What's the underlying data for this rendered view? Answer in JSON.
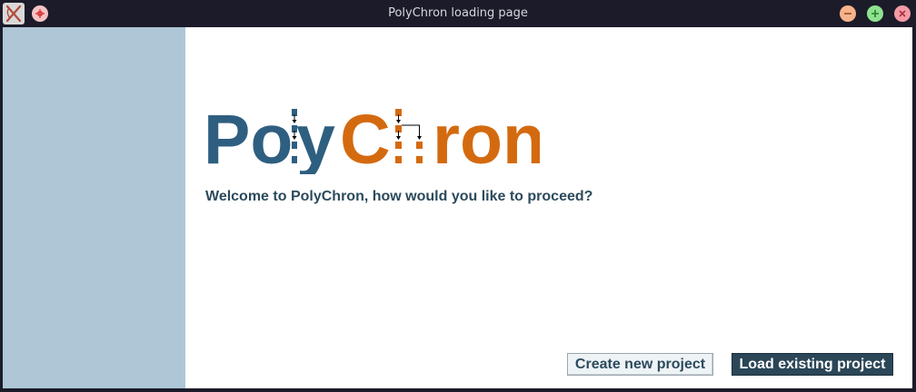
{
  "window": {
    "title": "PolyChron loading page"
  },
  "logo": {
    "part1": "Po",
    "part2": "y",
    "part3": "C",
    "part4": "ron",
    "color_blue": "#2e5f80",
    "color_orange": "#d46a0f"
  },
  "main": {
    "welcome": "Welcome to PolyChron, how would you like to proceed?"
  },
  "buttons": {
    "create_label": "Create new project",
    "load_label": "Load existing project"
  },
  "colors": {
    "sidebar": "#aec6d6",
    "text_dark": "#2c4a5c",
    "primary_button": "#2b4657"
  }
}
